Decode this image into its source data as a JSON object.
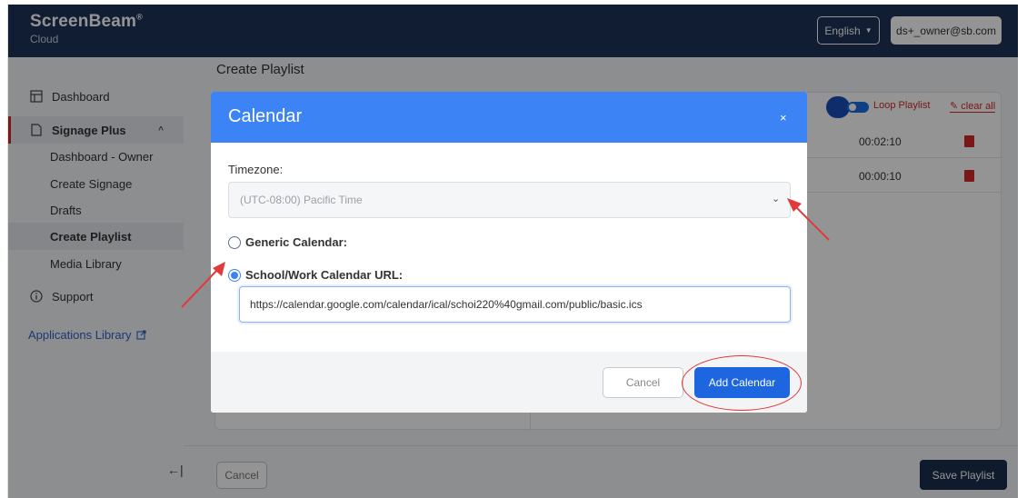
{
  "app": {
    "brand": "ScreenBeam",
    "brand_mark": "®",
    "brand_sub": "Cloud",
    "language": "English",
    "user": "ds+_owner@sb.com"
  },
  "sidebar": {
    "dashboard": "Dashboard",
    "signage_plus": "Signage Plus",
    "sub_items": [
      "Dashboard - Owner",
      "Create Signage",
      "Drafts",
      "Create Playlist",
      "Media Library"
    ],
    "support": "Support",
    "apps_library": "Applications Library",
    "collapse": "←|"
  },
  "main": {
    "page_title": "Create Playlist",
    "loop_playlist": "Loop Playlist",
    "clear_all": "clear all",
    "rows": [
      {
        "duration": "00:02:10"
      },
      {
        "duration": "00:00:10"
      }
    ],
    "cancel": "Cancel",
    "save": "Save Playlist"
  },
  "modal": {
    "title": "Calendar",
    "close": "×",
    "timezone_label": "Timezone:",
    "timezone_value": "(UTC-08:00) Pacific Time",
    "generic_option": "Generic Calendar:",
    "school_option": "School/Work Calendar URL:",
    "url_value": "https://calendar.google.com/calendar/ical/schoi220%40gmail.com/public/basic.ics",
    "cancel": "Cancel",
    "add": "Add Calendar"
  },
  "colors": {
    "topbar": "#1d3257",
    "modal_header": "#3c83f6",
    "primary_button": "#1d66e0",
    "annotation": "#e23a3a"
  }
}
